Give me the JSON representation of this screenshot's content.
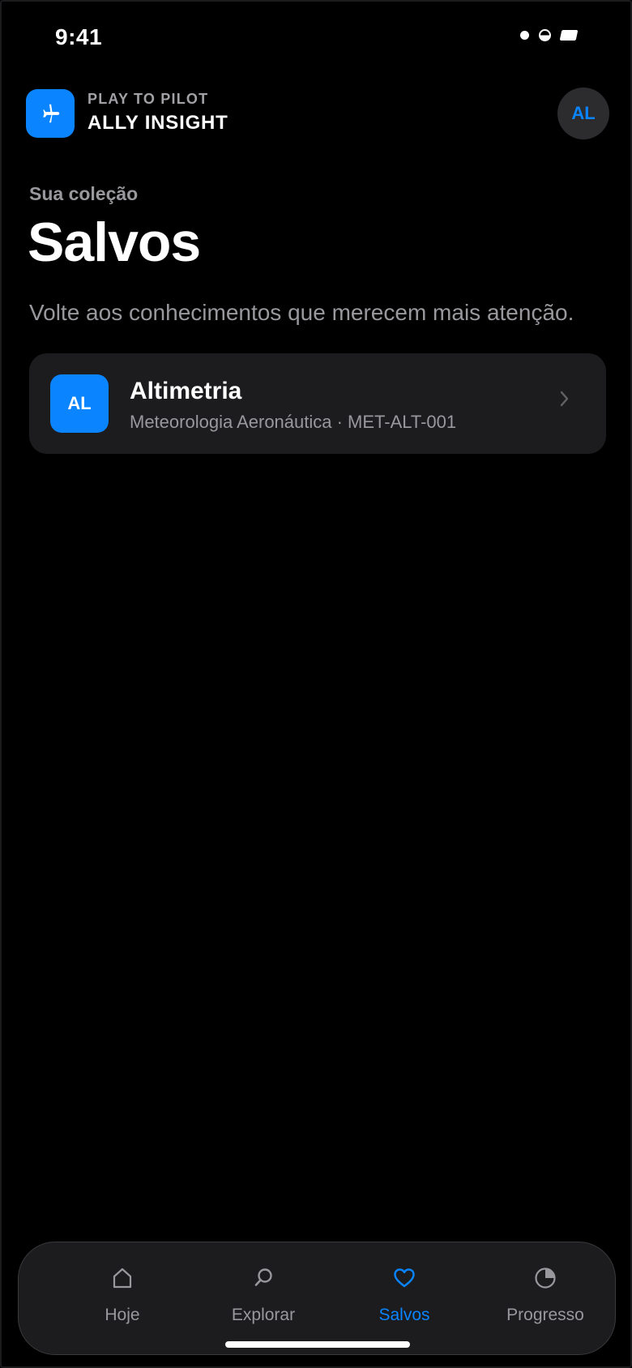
{
  "status_bar": {
    "time": "9:41"
  },
  "header": {
    "kicker": "PLAY TO PILOT",
    "title": "ALLY INSIGHT",
    "logo_icon": "airplane-icon",
    "avatar_initials": "AL"
  },
  "page": {
    "eyebrow": "Sua coleção",
    "title": "Salvos",
    "subtitle": "Volte aos conhecimentos que merecem mais atenção."
  },
  "saved_items": [
    {
      "badge": "AL",
      "title": "Altimetria",
      "meta": "Meteorologia Aeronáutica · MET-ALT-001",
      "chevron_icon": "chevron-right-icon"
    }
  ],
  "tab_bar": {
    "tabs": [
      {
        "label": "Hoje",
        "icon": "home-icon",
        "active": false
      },
      {
        "label": "Explorar",
        "icon": "search-icon",
        "active": false
      },
      {
        "label": "Salvos",
        "icon": "heart-icon",
        "active": true
      },
      {
        "label": "Progresso",
        "icon": "pie-chart-icon",
        "active": false
      }
    ]
  },
  "colors": {
    "accent": "#0a84ff",
    "background": "#000000",
    "surface": "#1c1c1e",
    "secondary_text": "#98989d"
  }
}
